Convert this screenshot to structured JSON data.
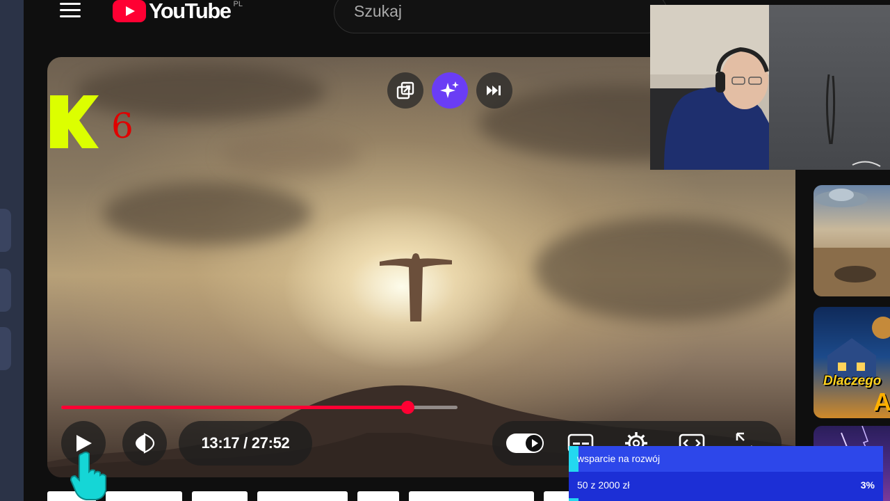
{
  "app": {
    "name": "YouTube",
    "region": "PL"
  },
  "header": {
    "search_placeholder": "Szukaj"
  },
  "player": {
    "channel_mark": "6",
    "time_display": "13:17 / 27:52",
    "progress": {
      "watched_fraction": 0.873,
      "buffered_fraction": 1.0
    },
    "top_buttons": [
      {
        "name": "miniplayer-icon"
      },
      {
        "name": "ai-sparkle-icon",
        "color": "#6a3df5"
      },
      {
        "name": "skip-next-icon"
      }
    ],
    "autoplay": "on"
  },
  "support_widget": {
    "title": "wsparcie na rozwój",
    "amount": "50 z 2000 zł",
    "percent": "3%",
    "percent_value": 3,
    "accent_color": "#23d8f0",
    "bg_color": "#1c2fd6"
  },
  "sidebar_thumbnails": [
    {
      "thumb_text": ""
    },
    {
      "thumb_text": "Dlaczego",
      "thumb_letter": "A"
    },
    {
      "thumb_text": ""
    }
  ],
  "colors": {
    "brand_red": "#ff0033",
    "background": "#0f0f0f"
  }
}
